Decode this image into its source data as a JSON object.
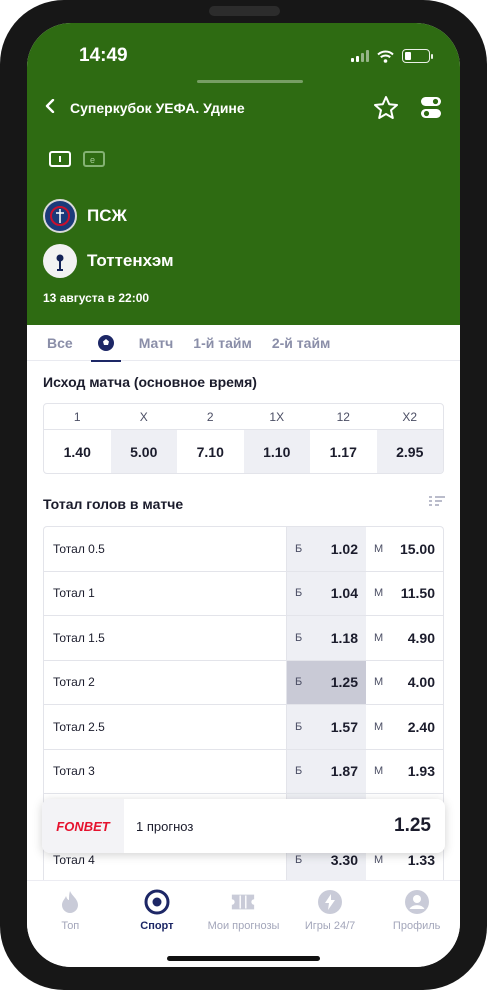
{
  "status": {
    "time": "14:49"
  },
  "header": {
    "title": "Суперкубок УЕФА. Удине",
    "team1": "ПСЖ",
    "team2": "Тоттенхэм",
    "date": "13 августа в 22:00"
  },
  "tabs": [
    {
      "label": "Все"
    },
    {
      "label": "Матч"
    },
    {
      "label": "1-й тайм"
    },
    {
      "label": "2-й тайм"
    }
  ],
  "result": {
    "title": "Исход матча (основное время)",
    "headers": [
      "1",
      "X",
      "2",
      "1X",
      "12",
      "X2"
    ],
    "values": [
      "1.40",
      "5.00",
      "7.10",
      "1.10",
      "1.17",
      "2.95"
    ]
  },
  "totals": {
    "title": "Тотал голов в матче",
    "over_tag": "Б",
    "under_tag": "М",
    "rows": [
      {
        "label": "Тотал 0.5",
        "over": "1.02",
        "under": "15.00"
      },
      {
        "label": "Тотал 1",
        "over": "1.04",
        "under": "11.50"
      },
      {
        "label": "Тотал 1.5",
        "over": "1.18",
        "under": "4.90"
      },
      {
        "label": "Тотал 2",
        "over": "1.25",
        "under": "4.00"
      },
      {
        "label": "Тотал 2.5",
        "over": "1.57",
        "under": "2.40"
      },
      {
        "label": "Тотал 3",
        "over": "1.87",
        "under": "1.93"
      },
      {
        "label": "",
        "over": "",
        "under": ""
      },
      {
        "label": "Тотал 4",
        "over": "3.30",
        "under": "1.33"
      }
    ]
  },
  "coupon": {
    "brand": "FONBET",
    "count": "1 прогноз",
    "total": "1.25"
  },
  "nav": [
    {
      "label": "Топ"
    },
    {
      "label": "Спорт"
    },
    {
      "label": "Мои прогнозы"
    },
    {
      "label": "Игры 24/7"
    },
    {
      "label": "Профиль"
    }
  ],
  "colors": {
    "header_bg": "#2e6b12",
    "accent": "#1d2766",
    "brand_red": "#e5122e"
  }
}
